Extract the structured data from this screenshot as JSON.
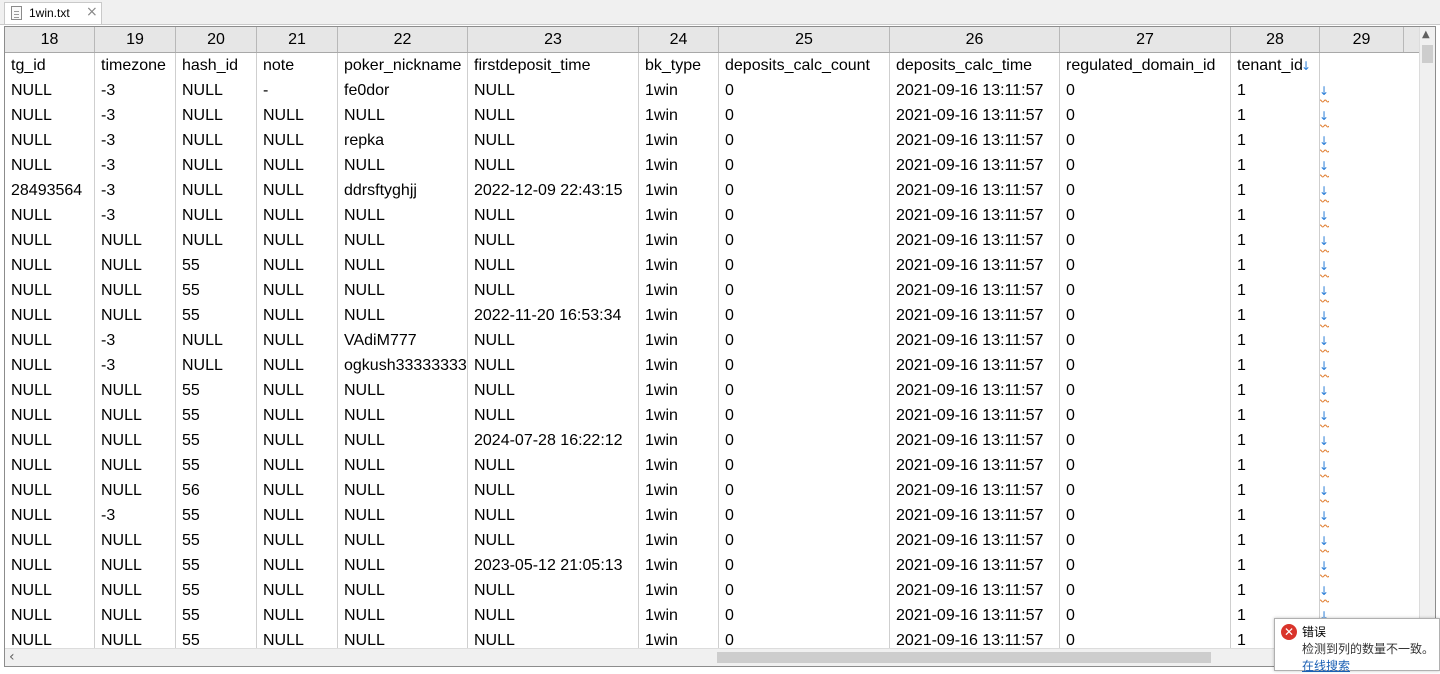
{
  "tab": {
    "title": "1win.txt",
    "close_glyph": "×",
    "icon": "file-icon"
  },
  "column_numbers": [
    "18",
    "19",
    "20",
    "21",
    "22",
    "23",
    "24",
    "25",
    "26",
    "27",
    "28",
    "29"
  ],
  "header_row": [
    "tg_id",
    "timezone",
    "hash_id",
    "note",
    "poker_nickname",
    "firstdeposit_time",
    "bk_type",
    "deposits_calc_count",
    "deposits_calc_time",
    "regulated_domain_id",
    "tenant_id"
  ],
  "rows": [
    [
      "NULL",
      "-3",
      "NULL",
      "-",
      "fe0dor",
      "NULL",
      "1win",
      "0",
      "2021-09-16 13:11:57",
      "0",
      "1"
    ],
    [
      "NULL",
      "-3",
      "NULL",
      "NULL",
      "NULL",
      "NULL",
      "1win",
      "0",
      "2021-09-16 13:11:57",
      "0",
      "1"
    ],
    [
      "NULL",
      "-3",
      "NULL",
      "NULL",
      "repka",
      "NULL",
      "1win",
      "0",
      "2021-09-16 13:11:57",
      "0",
      "1"
    ],
    [
      "NULL",
      "-3",
      "NULL",
      "NULL",
      "NULL",
      "NULL",
      "1win",
      "0",
      "2021-09-16 13:11:57",
      "0",
      "1"
    ],
    [
      "28493564",
      "-3",
      "NULL",
      "NULL",
      "ddrsftyghjj",
      "2022-12-09 22:43:15",
      "1win",
      "0",
      "2021-09-16 13:11:57",
      "0",
      "1"
    ],
    [
      "NULL",
      "-3",
      "NULL",
      "NULL",
      "NULL",
      "NULL",
      "1win",
      "0",
      "2021-09-16 13:11:57",
      "0",
      "1"
    ],
    [
      "NULL",
      "NULL",
      "NULL",
      "NULL",
      "NULL",
      "NULL",
      "1win",
      "0",
      "2021-09-16 13:11:57",
      "0",
      "1"
    ],
    [
      "NULL",
      "NULL",
      "55",
      "NULL",
      "NULL",
      "NULL",
      "1win",
      "0",
      "2021-09-16 13:11:57",
      "0",
      "1"
    ],
    [
      "NULL",
      "NULL",
      "55",
      "NULL",
      "NULL",
      "NULL",
      "1win",
      "0",
      "2021-09-16 13:11:57",
      "0",
      "1"
    ],
    [
      "NULL",
      "NULL",
      "55",
      "NULL",
      "NULL",
      "2022-11-20 16:53:34",
      "1win",
      "0",
      "2021-09-16 13:11:57",
      "0",
      "1"
    ],
    [
      "NULL",
      "-3",
      "NULL",
      "NULL",
      "VAdiM777",
      "NULL",
      "1win",
      "0",
      "2021-09-16 13:11:57",
      "0",
      "1"
    ],
    [
      "NULL",
      "-3",
      "NULL",
      "NULL",
      "ogkush33333333",
      "NULL",
      "1win",
      "0",
      "2021-09-16 13:11:57",
      "0",
      "1"
    ],
    [
      "NULL",
      "NULL",
      "55",
      "NULL",
      "NULL",
      "NULL",
      "1win",
      "0",
      "2021-09-16 13:11:57",
      "0",
      "1"
    ],
    [
      "NULL",
      "NULL",
      "55",
      "NULL",
      "NULL",
      "NULL",
      "1win",
      "0",
      "2021-09-16 13:11:57",
      "0",
      "1"
    ],
    [
      "NULL",
      "NULL",
      "55",
      "NULL",
      "NULL",
      "2024-07-28 16:22:12",
      "1win",
      "0",
      "2021-09-16 13:11:57",
      "0",
      "1"
    ],
    [
      "NULL",
      "NULL",
      "55",
      "NULL",
      "NULL",
      "NULL",
      "1win",
      "0",
      "2021-09-16 13:11:57",
      "0",
      "1"
    ],
    [
      "NULL",
      "NULL",
      "56",
      "NULL",
      "NULL",
      "NULL",
      "1win",
      "0",
      "2021-09-16 13:11:57",
      "0",
      "1"
    ],
    [
      "NULL",
      "-3",
      "55",
      "NULL",
      "NULL",
      "NULL",
      "1win",
      "0",
      "2021-09-16 13:11:57",
      "0",
      "1"
    ],
    [
      "NULL",
      "NULL",
      "55",
      "NULL",
      "NULL",
      "NULL",
      "1win",
      "0",
      "2021-09-16 13:11:57",
      "0",
      "1"
    ],
    [
      "NULL",
      "NULL",
      "55",
      "NULL",
      "NULL",
      "2023-05-12 21:05:13",
      "1win",
      "0",
      "2021-09-16 13:11:57",
      "0",
      "1"
    ],
    [
      "NULL",
      "NULL",
      "55",
      "NULL",
      "NULL",
      "NULL",
      "1win",
      "0",
      "2021-09-16 13:11:57",
      "0",
      "1"
    ],
    [
      "NULL",
      "NULL",
      "55",
      "NULL",
      "NULL",
      "NULL",
      "1win",
      "0",
      "2021-09-16 13:11:57",
      "0",
      "1"
    ],
    [
      "NULL",
      "NULL",
      "55",
      "NULL",
      "NULL",
      "NULL",
      "1win",
      "0",
      "2021-09-16 13:11:57",
      "0",
      "1"
    ]
  ],
  "line_end_marker": "↓",
  "colors": {
    "accent": "#2b7ed8",
    "error": "#d9342b",
    "wave": "#e07a2a"
  },
  "scrollbar": {
    "up_glyph": "▲",
    "left_glyph": "‹"
  },
  "toast": {
    "icon": "error-icon",
    "icon_glyph": "✕",
    "title": "错误",
    "message": "检测到列的数量不一致。",
    "link": "在线搜索"
  }
}
